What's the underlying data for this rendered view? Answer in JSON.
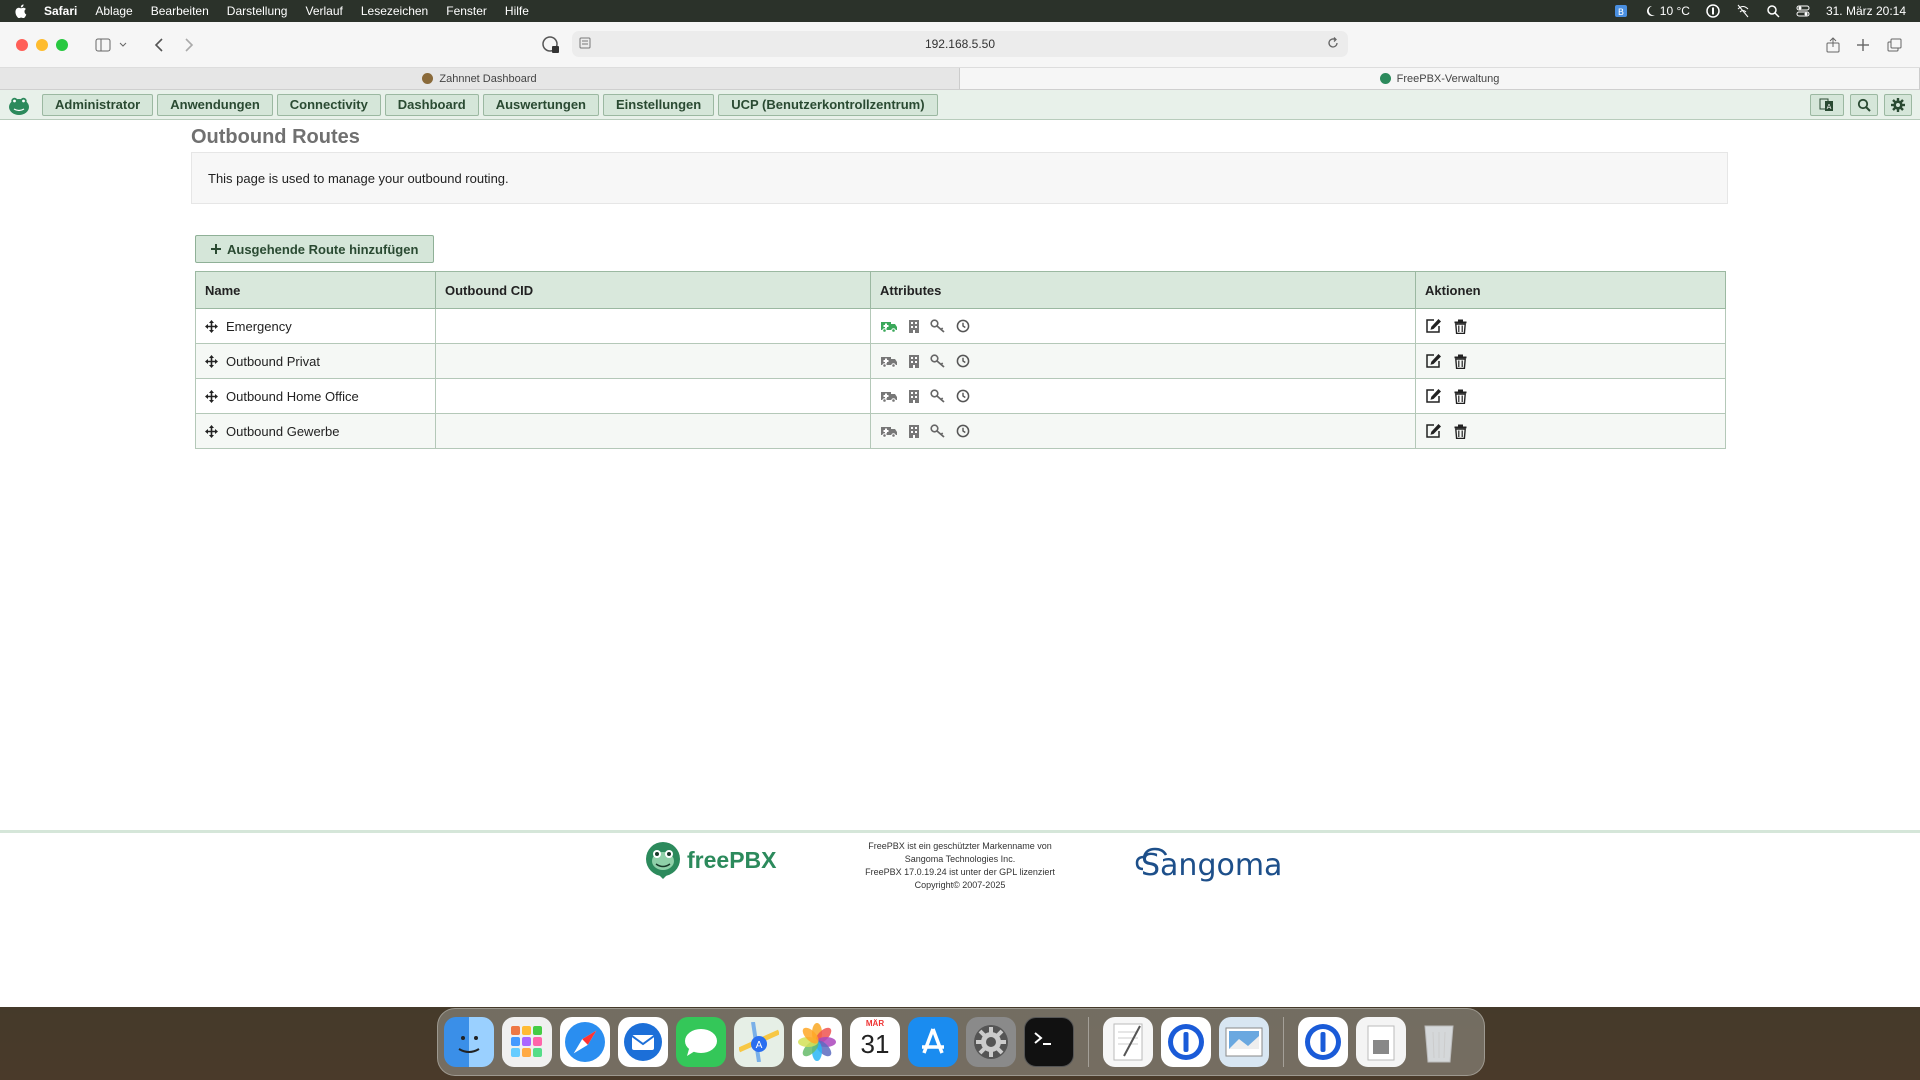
{
  "menubar": {
    "app": "Safari",
    "items": [
      "Ablage",
      "Bearbeiten",
      "Darstellung",
      "Verlauf",
      "Lesezeichen",
      "Fenster",
      "Hilfe"
    ],
    "weather": "10 °C",
    "datetime": "31. März 20:14"
  },
  "browser": {
    "url": "192.168.5.50",
    "tabs": [
      {
        "label": "Zahnnet Dashboard",
        "active": false
      },
      {
        "label": "FreePBX-Verwaltung",
        "active": true
      }
    ]
  },
  "nav": {
    "items": [
      "Administrator",
      "Anwendungen",
      "Connectivity",
      "Dashboard",
      "Auswertungen",
      "Einstellungen",
      "UCP (Benutzerkontrollzentrum)"
    ]
  },
  "page": {
    "title": "Outbound Routes",
    "description": "This page is used to manage your outbound routing.",
    "add_button": "Ausgehende Route hinzufügen"
  },
  "table": {
    "headers": [
      "Name",
      "Outbound CID",
      "Attributes",
      "Aktionen"
    ],
    "rows": [
      {
        "name": "Emergency",
        "cid": "",
        "emergency_active": true
      },
      {
        "name": "Outbound Privat",
        "cid": "",
        "emergency_active": false
      },
      {
        "name": "Outbound Home Office",
        "cid": "",
        "emergency_active": false
      },
      {
        "name": "Outbound Gewerbe",
        "cid": "",
        "emergency_active": false
      }
    ]
  },
  "footer": {
    "brand": "freePBX",
    "legal_lines": [
      "FreePBX ist ein geschützter Markenname von",
      "Sangoma Technologies Inc.",
      "FreePBX 17.0.19.24 ist unter der GPL lizenziert",
      "Copyright© 2007-2025"
    ],
    "partner": "Sangoma"
  },
  "dock": {
    "calendar_month": "MÄR",
    "calendar_day": "31"
  },
  "colors": {
    "nav_bg": "#e8f1ea",
    "button_bg": "#d5e6d9",
    "button_border": "#9bb8a1",
    "brand_green": "#2c8a5c",
    "sangoma_blue": "#1d4f8a"
  }
}
